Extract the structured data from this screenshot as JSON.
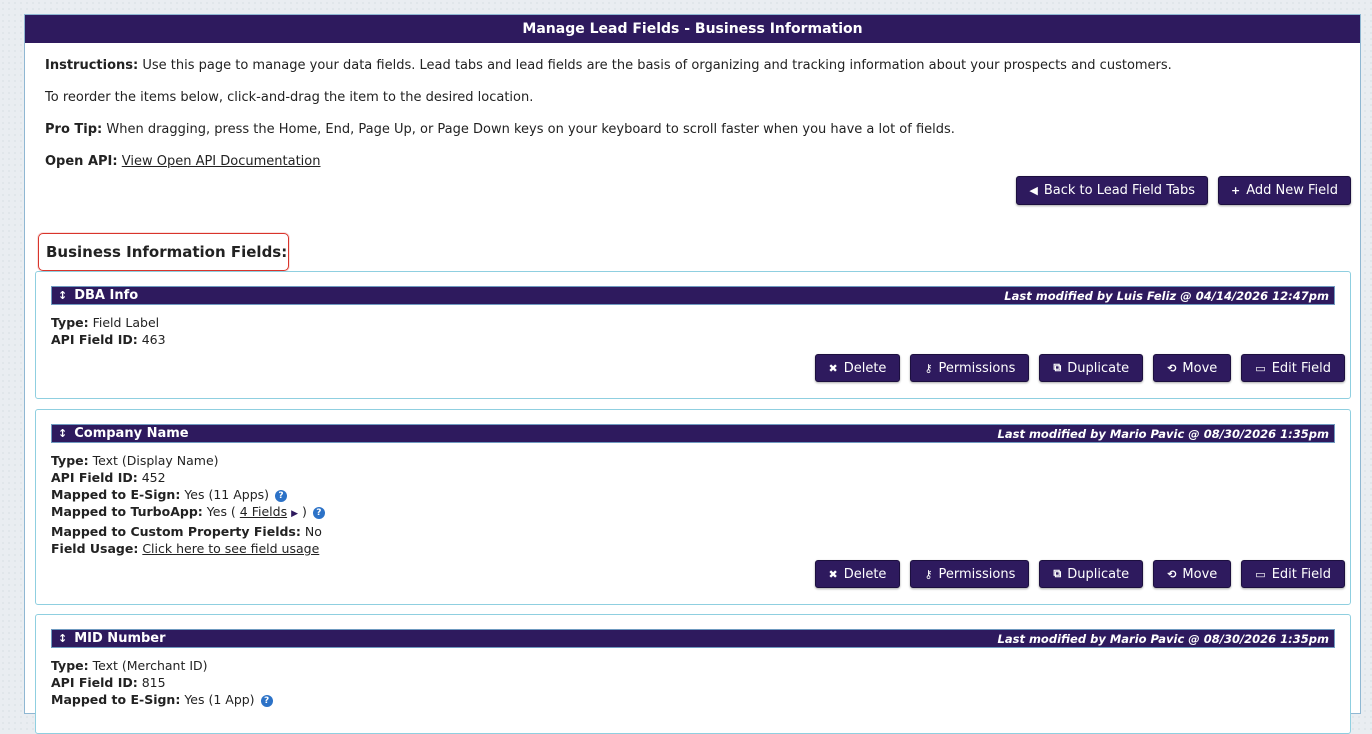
{
  "page": {
    "title": "Manage Lead Fields - Business Information"
  },
  "instructions": {
    "label": "Instructions:",
    "text": "Use this page to manage your data fields. Lead tabs and lead fields are the basis of organizing and tracking information about your prospects and customers.",
    "reorder": "To reorder the items below, click-and-drag the item to the desired location.",
    "protip_label": "Pro Tip:",
    "protip_text": "When dragging, press the Home, End, Page Up, or Page Down keys on your keyboard to scroll faster when you have a lot of fields.",
    "api_label": "Open API:",
    "api_link": "View Open API Documentation"
  },
  "toolbar": {
    "back_label": "Back to Lead Field Tabs",
    "add_label": "Add New Field"
  },
  "section_title": "Business Information Fields:",
  "labels": {
    "type": "Type:",
    "api_id": "API Field ID:",
    "esign": "Mapped to E-Sign:",
    "turbo": "Mapped to TurboApp:",
    "custom": "Mapped to Custom Property Fields:",
    "usage": "Field Usage:"
  },
  "actions": {
    "delete": "Delete",
    "permissions": "Permissions",
    "duplicate": "Duplicate",
    "move": "Move",
    "edit": "Edit Field"
  },
  "fields": [
    {
      "name": "DBA Info",
      "modified": "Last modified by Luis Feliz @ 04/14/2026 12:47pm",
      "type": "Field Label",
      "api_id": "463"
    },
    {
      "name": "Company Name",
      "modified": "Last modified by Mario Pavic @ 08/30/2026 1:35pm",
      "type": "Text (Display Name)",
      "api_id": "452",
      "esign": "Yes (11 Apps)",
      "turbo_prefix": "Yes (",
      "turbo_link": "4 Fields",
      "turbo_suffix": ")",
      "custom": "No",
      "usage_link": "Click here to see field usage"
    },
    {
      "name": "MID Number",
      "modified": "Last modified by Mario Pavic @ 08/30/2026 1:35pm",
      "type": "Text (Merchant ID)",
      "api_id": "815",
      "esign": "Yes (1 App)"
    }
  ],
  "colors": {
    "header_bg": "#2e1a5e",
    "border": "#8fcfe0",
    "highlight": "#d9342b",
    "help": "#2c72c7"
  }
}
